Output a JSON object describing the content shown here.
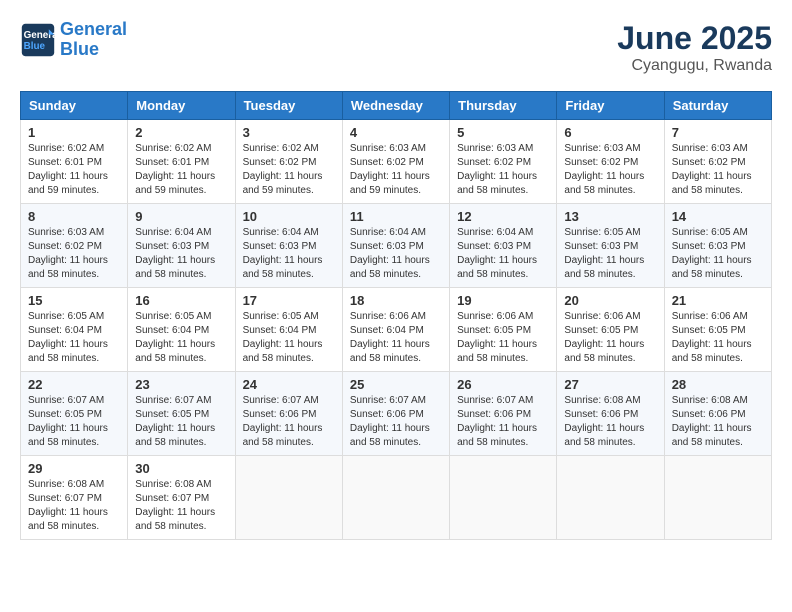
{
  "logo": {
    "line1": "General",
    "line2": "Blue"
  },
  "title": "June 2025",
  "location": "Cyangugu, Rwanda",
  "days_of_week": [
    "Sunday",
    "Monday",
    "Tuesday",
    "Wednesday",
    "Thursday",
    "Friday",
    "Saturday"
  ],
  "weeks": [
    [
      {
        "day": 1,
        "info": "Sunrise: 6:02 AM\nSunset: 6:01 PM\nDaylight: 11 hours\nand 59 minutes."
      },
      {
        "day": 2,
        "info": "Sunrise: 6:02 AM\nSunset: 6:01 PM\nDaylight: 11 hours\nand 59 minutes."
      },
      {
        "day": 3,
        "info": "Sunrise: 6:02 AM\nSunset: 6:02 PM\nDaylight: 11 hours\nand 59 minutes."
      },
      {
        "day": 4,
        "info": "Sunrise: 6:03 AM\nSunset: 6:02 PM\nDaylight: 11 hours\nand 59 minutes."
      },
      {
        "day": 5,
        "info": "Sunrise: 6:03 AM\nSunset: 6:02 PM\nDaylight: 11 hours\nand 58 minutes."
      },
      {
        "day": 6,
        "info": "Sunrise: 6:03 AM\nSunset: 6:02 PM\nDaylight: 11 hours\nand 58 minutes."
      },
      {
        "day": 7,
        "info": "Sunrise: 6:03 AM\nSunset: 6:02 PM\nDaylight: 11 hours\nand 58 minutes."
      }
    ],
    [
      {
        "day": 8,
        "info": "Sunrise: 6:03 AM\nSunset: 6:02 PM\nDaylight: 11 hours\nand 58 minutes."
      },
      {
        "day": 9,
        "info": "Sunrise: 6:04 AM\nSunset: 6:03 PM\nDaylight: 11 hours\nand 58 minutes."
      },
      {
        "day": 10,
        "info": "Sunrise: 6:04 AM\nSunset: 6:03 PM\nDaylight: 11 hours\nand 58 minutes."
      },
      {
        "day": 11,
        "info": "Sunrise: 6:04 AM\nSunset: 6:03 PM\nDaylight: 11 hours\nand 58 minutes."
      },
      {
        "day": 12,
        "info": "Sunrise: 6:04 AM\nSunset: 6:03 PM\nDaylight: 11 hours\nand 58 minutes."
      },
      {
        "day": 13,
        "info": "Sunrise: 6:05 AM\nSunset: 6:03 PM\nDaylight: 11 hours\nand 58 minutes."
      },
      {
        "day": 14,
        "info": "Sunrise: 6:05 AM\nSunset: 6:03 PM\nDaylight: 11 hours\nand 58 minutes."
      }
    ],
    [
      {
        "day": 15,
        "info": "Sunrise: 6:05 AM\nSunset: 6:04 PM\nDaylight: 11 hours\nand 58 minutes."
      },
      {
        "day": 16,
        "info": "Sunrise: 6:05 AM\nSunset: 6:04 PM\nDaylight: 11 hours\nand 58 minutes."
      },
      {
        "day": 17,
        "info": "Sunrise: 6:05 AM\nSunset: 6:04 PM\nDaylight: 11 hours\nand 58 minutes."
      },
      {
        "day": 18,
        "info": "Sunrise: 6:06 AM\nSunset: 6:04 PM\nDaylight: 11 hours\nand 58 minutes."
      },
      {
        "day": 19,
        "info": "Sunrise: 6:06 AM\nSunset: 6:05 PM\nDaylight: 11 hours\nand 58 minutes."
      },
      {
        "day": 20,
        "info": "Sunrise: 6:06 AM\nSunset: 6:05 PM\nDaylight: 11 hours\nand 58 minutes."
      },
      {
        "day": 21,
        "info": "Sunrise: 6:06 AM\nSunset: 6:05 PM\nDaylight: 11 hours\nand 58 minutes."
      }
    ],
    [
      {
        "day": 22,
        "info": "Sunrise: 6:07 AM\nSunset: 6:05 PM\nDaylight: 11 hours\nand 58 minutes."
      },
      {
        "day": 23,
        "info": "Sunrise: 6:07 AM\nSunset: 6:05 PM\nDaylight: 11 hours\nand 58 minutes."
      },
      {
        "day": 24,
        "info": "Sunrise: 6:07 AM\nSunset: 6:06 PM\nDaylight: 11 hours\nand 58 minutes."
      },
      {
        "day": 25,
        "info": "Sunrise: 6:07 AM\nSunset: 6:06 PM\nDaylight: 11 hours\nand 58 minutes."
      },
      {
        "day": 26,
        "info": "Sunrise: 6:07 AM\nSunset: 6:06 PM\nDaylight: 11 hours\nand 58 minutes."
      },
      {
        "day": 27,
        "info": "Sunrise: 6:08 AM\nSunset: 6:06 PM\nDaylight: 11 hours\nand 58 minutes."
      },
      {
        "day": 28,
        "info": "Sunrise: 6:08 AM\nSunset: 6:06 PM\nDaylight: 11 hours\nand 58 minutes."
      }
    ],
    [
      {
        "day": 29,
        "info": "Sunrise: 6:08 AM\nSunset: 6:07 PM\nDaylight: 11 hours\nand 58 minutes."
      },
      {
        "day": 30,
        "info": "Sunrise: 6:08 AM\nSunset: 6:07 PM\nDaylight: 11 hours\nand 58 minutes."
      },
      null,
      null,
      null,
      null,
      null
    ]
  ]
}
